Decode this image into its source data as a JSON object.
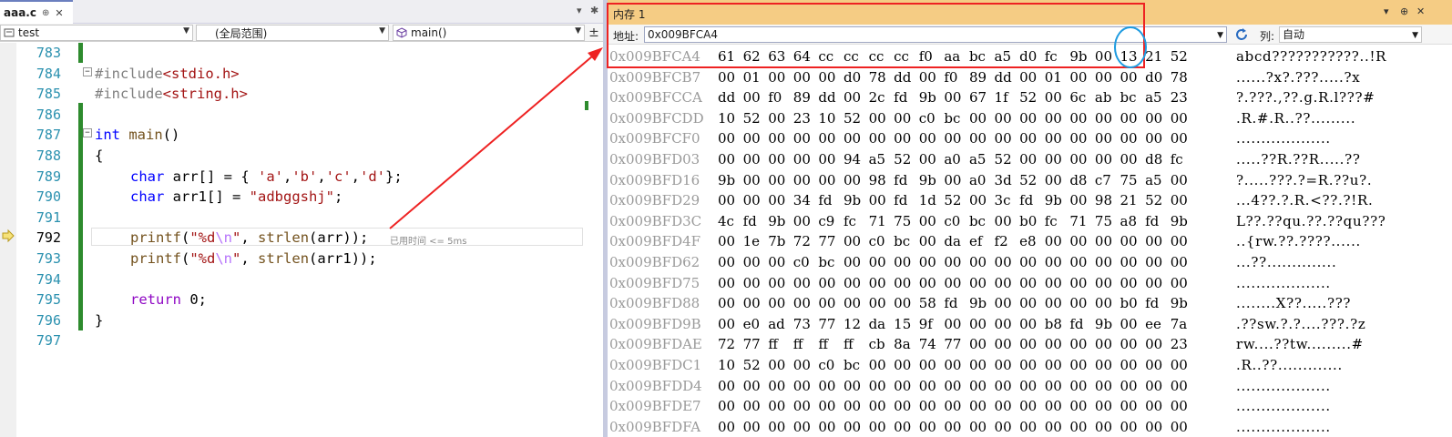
{
  "editor": {
    "tab": {
      "name": "aaa.c",
      "pin": "⊕",
      "close": "✕"
    },
    "tab_controls": {
      "dropdown": "▾",
      "gear": "✱"
    },
    "nav": {
      "project": "test",
      "scope": "(全局范围)",
      "function": "main()",
      "split": "±"
    },
    "lines": [
      {
        "num": "783",
        "code": ""
      },
      {
        "num": "784",
        "code": "#include<stdio.h>"
      },
      {
        "num": "785",
        "code": "#include<string.h>"
      },
      {
        "num": "786",
        "code": ""
      },
      {
        "num": "787",
        "code": "int main()"
      },
      {
        "num": "788",
        "code": "{"
      },
      {
        "num": "789",
        "code": "char arr[] = { 'a','b','c','d'};"
      },
      {
        "num": "790",
        "code": "char arr1[] = \"adbggshj\";"
      },
      {
        "num": "791",
        "code": ""
      },
      {
        "num": "792",
        "code": "printf(\"%d\\n\", strlen(arr));"
      },
      {
        "num": "793",
        "code": "printf(\"%d\\n\", strlen(arr1));"
      },
      {
        "num": "794",
        "code": ""
      },
      {
        "num": "795",
        "code": "return 0;"
      },
      {
        "num": "796",
        "code": "}"
      },
      {
        "num": "797",
        "code": ""
      }
    ],
    "perf_tip": "已用时间 <= 5ms"
  },
  "memory": {
    "title": "内存 1",
    "controls": {
      "dropdown": "▾",
      "pin": "⊕",
      "close": "✕"
    },
    "address_label": "地址:",
    "address_value": "0x009BFCA4",
    "columns_label": "列:",
    "columns_value": "自动",
    "rows": [
      {
        "addr": "0x009BFCA4",
        "bytes": [
          "61",
          "62",
          "63",
          "64",
          "cc",
          "cc",
          "cc",
          "cc",
          "f0",
          "aa",
          "bc",
          "a5",
          "d0",
          "fc",
          "9b",
          "00",
          "13",
          "21",
          "52"
        ],
        "ascii": "abcd???????????..!R"
      },
      {
        "addr": "0x009BFCB7",
        "bytes": [
          "00",
          "01",
          "00",
          "00",
          "00",
          "d0",
          "78",
          "dd",
          "00",
          "f0",
          "89",
          "dd",
          "00",
          "01",
          "00",
          "00",
          "00",
          "d0",
          "78"
        ],
        "ascii": "......?x?.???.....?x"
      },
      {
        "addr": "0x009BFCCA",
        "bytes": [
          "dd",
          "00",
          "f0",
          "89",
          "dd",
          "00",
          "2c",
          "fd",
          "9b",
          "00",
          "67",
          "1f",
          "52",
          "00",
          "6c",
          "ab",
          "bc",
          "a5",
          "23"
        ],
        "ascii": "?.???.,??.g.R.l???#"
      },
      {
        "addr": "0x009BFCDD",
        "bytes": [
          "10",
          "52",
          "00",
          "23",
          "10",
          "52",
          "00",
          "00",
          "c0",
          "bc",
          "00",
          "00",
          "00",
          "00",
          "00",
          "00",
          "00",
          "00",
          "00"
        ],
        "ascii": ".R.#.R..??........."
      },
      {
        "addr": "0x009BFCF0",
        "bytes": [
          "00",
          "00",
          "00",
          "00",
          "00",
          "00",
          "00",
          "00",
          "00",
          "00",
          "00",
          "00",
          "00",
          "00",
          "00",
          "00",
          "00",
          "00",
          "00"
        ],
        "ascii": "..................."
      },
      {
        "addr": "0x009BFD03",
        "bytes": [
          "00",
          "00",
          "00",
          "00",
          "00",
          "94",
          "a5",
          "52",
          "00",
          "a0",
          "a5",
          "52",
          "00",
          "00",
          "00",
          "00",
          "00",
          "d8",
          "fc"
        ],
        "ascii": ".....??R.??R.....??"
      },
      {
        "addr": "0x009BFD16",
        "bytes": [
          "9b",
          "00",
          "00",
          "00",
          "00",
          "00",
          "98",
          "fd",
          "9b",
          "00",
          "a0",
          "3d",
          "52",
          "00",
          "d8",
          "c7",
          "75",
          "a5",
          "00"
        ],
        "ascii": "?.....???.?=R.??u?."
      },
      {
        "addr": "0x009BFD29",
        "bytes": [
          "00",
          "00",
          "00",
          "34",
          "fd",
          "9b",
          "00",
          "fd",
          "1d",
          "52",
          "00",
          "3c",
          "fd",
          "9b",
          "00",
          "98",
          "21",
          "52",
          "00"
        ],
        "ascii": "...4??.?.R.<??.?!R."
      },
      {
        "addr": "0x009BFD3C",
        "bytes": [
          "4c",
          "fd",
          "9b",
          "00",
          "c9",
          "fc",
          "71",
          "75",
          "00",
          "c0",
          "bc",
          "00",
          "b0",
          "fc",
          "71",
          "75",
          "a8",
          "fd",
          "9b"
        ],
        "ascii": "L??.??qu.??.??qu???"
      },
      {
        "addr": "0x009BFD4F",
        "bytes": [
          "00",
          "1e",
          "7b",
          "72",
          "77",
          "00",
          "c0",
          "bc",
          "00",
          "da",
          "ef",
          "f2",
          "e8",
          "00",
          "00",
          "00",
          "00",
          "00",
          "00"
        ],
        "ascii": "..{rw.??.????......"
      },
      {
        "addr": "0x009BFD62",
        "bytes": [
          "00",
          "00",
          "00",
          "c0",
          "bc",
          "00",
          "00",
          "00",
          "00",
          "00",
          "00",
          "00",
          "00",
          "00",
          "00",
          "00",
          "00",
          "00",
          "00"
        ],
        "ascii": "...??.............."
      },
      {
        "addr": "0x009BFD75",
        "bytes": [
          "00",
          "00",
          "00",
          "00",
          "00",
          "00",
          "00",
          "00",
          "00",
          "00",
          "00",
          "00",
          "00",
          "00",
          "00",
          "00",
          "00",
          "00",
          "00"
        ],
        "ascii": "..................."
      },
      {
        "addr": "0x009BFD88",
        "bytes": [
          "00",
          "00",
          "00",
          "00",
          "00",
          "00",
          "00",
          "00",
          "58",
          "fd",
          "9b",
          "00",
          "00",
          "00",
          "00",
          "00",
          "b0",
          "fd",
          "9b"
        ],
        "ascii": "........X??.....???"
      },
      {
        "addr": "0x009BFD9B",
        "bytes": [
          "00",
          "e0",
          "ad",
          "73",
          "77",
          "12",
          "da",
          "15",
          "9f",
          "00",
          "00",
          "00",
          "00",
          "b8",
          "fd",
          "9b",
          "00",
          "ee",
          "7a"
        ],
        "ascii": ".??sw.?.?....???.?z"
      },
      {
        "addr": "0x009BFDAE",
        "bytes": [
          "72",
          "77",
          "ff",
          "ff",
          "ff",
          "ff",
          "cb",
          "8a",
          "74",
          "77",
          "00",
          "00",
          "00",
          "00",
          "00",
          "00",
          "00",
          "00",
          "23"
        ],
        "ascii": "rw....??tw.........#"
      },
      {
        "addr": "0x009BFDC1",
        "bytes": [
          "10",
          "52",
          "00",
          "00",
          "c0",
          "bc",
          "00",
          "00",
          "00",
          "00",
          "00",
          "00",
          "00",
          "00",
          "00",
          "00",
          "00",
          "00",
          "00"
        ],
        "ascii": ".R..??............."
      },
      {
        "addr": "0x009BFDD4",
        "bytes": [
          "00",
          "00",
          "00",
          "00",
          "00",
          "00",
          "00",
          "00",
          "00",
          "00",
          "00",
          "00",
          "00",
          "00",
          "00",
          "00",
          "00",
          "00",
          "00"
        ],
        "ascii": "..................."
      },
      {
        "addr": "0x009BFDE7",
        "bytes": [
          "00",
          "00",
          "00",
          "00",
          "00",
          "00",
          "00",
          "00",
          "00",
          "00",
          "00",
          "00",
          "00",
          "00",
          "00",
          "00",
          "00",
          "00",
          "00"
        ],
        "ascii": "..................."
      },
      {
        "addr": "0x009BFDFA",
        "bytes": [
          "00",
          "00",
          "00",
          "00",
          "00",
          "00",
          "00",
          "00",
          "00",
          "00",
          "00",
          "00",
          "00",
          "00",
          "00",
          "00",
          "00",
          "00",
          "00"
        ],
        "ascii": "..................."
      }
    ]
  },
  "colors": {
    "annotation_red": "#ee2222",
    "annotation_blue": "#1e9be0",
    "memory_title_bg": "#f5cc84",
    "change_bar_green": "#2e8b2e"
  }
}
